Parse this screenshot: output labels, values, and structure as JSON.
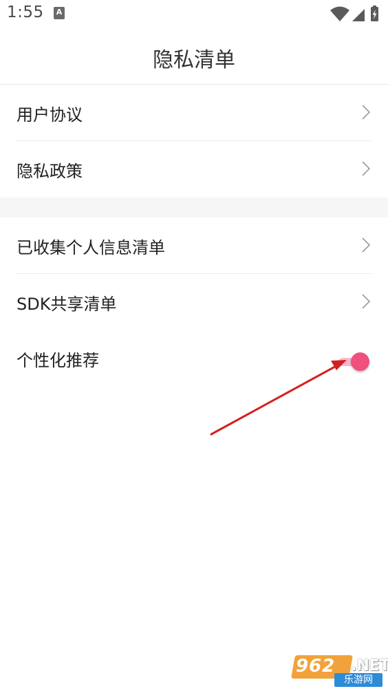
{
  "status_bar": {
    "time": "1:55",
    "notif_icon": "text-a-icon",
    "icons": [
      "wifi-icon",
      "signal-icon",
      "battery-charging-icon"
    ]
  },
  "header": {
    "title": "隐私清单"
  },
  "sections": [
    {
      "items": [
        {
          "label": "用户协议",
          "icon": "chevron-right-icon"
        },
        {
          "label": "隐私政策",
          "icon": "chevron-right-icon"
        }
      ]
    },
    {
      "items": [
        {
          "label": "已收集个人信息清单",
          "icon": "chevron-right-icon"
        },
        {
          "label": "SDK共享清单",
          "icon": "chevron-right-icon"
        },
        {
          "label": "个性化推荐",
          "toggle": true
        }
      ]
    }
  ],
  "colors": {
    "toggle_knob": "#f0507e",
    "toggle_track": "#f7b9cd",
    "arrow": "#d42020"
  },
  "watermark": {
    "logo": "962",
    "suffix": ".NET",
    "sub": "乐游网"
  }
}
